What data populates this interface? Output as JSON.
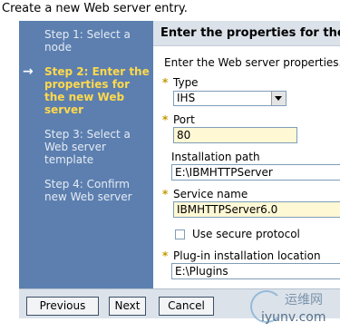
{
  "top_note": "Create a new Web server entry.",
  "steps": [
    {
      "label": "Step 1: Select a node",
      "current": false
    },
    {
      "label": "Step 2: Enter the properties for the new Web server",
      "current": true
    },
    {
      "label": "Step 3: Select a Web server template",
      "current": false
    },
    {
      "label": "Step 4: Confirm new Web server",
      "current": false
    }
  ],
  "current_step_marker": "→",
  "content": {
    "header": "Enter the properties for the new Web server",
    "intro": "Enter the Web server properties.",
    "required_marker": "*",
    "type": {
      "label": "Type",
      "value": "IHS"
    },
    "port": {
      "label": "Port",
      "value": "80"
    },
    "install_path": {
      "label": "Installation path",
      "value": "E:\\IBMHTTPServer"
    },
    "service_name": {
      "label": "Service name",
      "value": "IBMHTTPServer6.0"
    },
    "secure_protocol": {
      "label": "Use secure protocol",
      "checked": false
    },
    "plugin_location": {
      "label": "Plug-in installation location",
      "value": "E:\\Plugins"
    }
  },
  "buttons": {
    "previous": "Previous",
    "next": "Next",
    "cancel": "Cancel"
  },
  "watermark": {
    "chinese": "运维网",
    "url": "iyunv.com"
  },
  "colors": {
    "step_panel": "#5c7fb0",
    "current_step": "#ffd94a",
    "header_bar": "#dbe2ea",
    "required_field": "#fff8d5",
    "required_marker": "#c19a00"
  }
}
